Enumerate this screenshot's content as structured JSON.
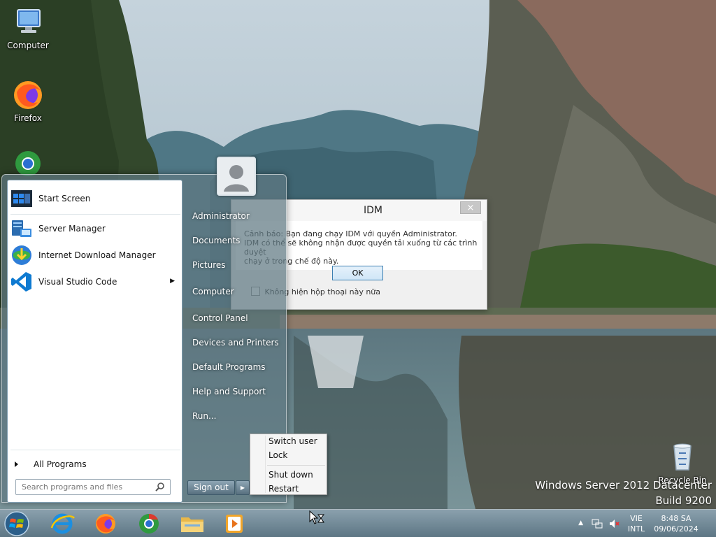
{
  "desktop": {
    "icons": [
      {
        "label": "Computer"
      },
      {
        "label": "Firefox"
      },
      {
        "label": "Recycle Bin"
      }
    ],
    "watermark": {
      "line1": "Windows Server 2012 Datacenter",
      "line2": "Build 9200"
    }
  },
  "idm_dialog": {
    "title": "IDM",
    "close_label": "×",
    "message_line1": "Cảnh báo: Bạn đang chạy IDM với quyền Administrator.",
    "message_line2": "IDM có thể sẽ không nhận được quyền tải xuống từ các trình duyệt",
    "message_line3": "chạy ở trong chế độ này.",
    "ok_label": "OK",
    "checkbox_label": "Không hiện hộp thoại này nữa",
    "checkbox_checked": false
  },
  "start_menu": {
    "programs": [
      {
        "label": "Start Screen",
        "icon": "start-screen-icon"
      },
      {
        "label": "Server Manager",
        "icon": "server-manager-icon"
      },
      {
        "label": "Internet Download Manager",
        "icon": "idm-icon"
      },
      {
        "label": "Visual Studio Code",
        "icon": "vscode-icon",
        "submenu_arrow": "▶"
      }
    ],
    "all_programs": "All Programs",
    "search_placeholder": "Search programs and files",
    "places": [
      "Administrator",
      "Documents",
      "Pictures",
      "Computer",
      "Control Panel",
      "Devices and Printers",
      "Default Programs",
      "Help and Support",
      "Run..."
    ],
    "sign_out": "Sign out",
    "power_arrow": "▶"
  },
  "power_menu": {
    "items": [
      "Switch user",
      "Lock",
      "Shut down",
      "Restart"
    ]
  },
  "taskbar": {
    "pinned": [
      "internet-explorer-icon",
      "firefox-icon",
      "chrome-icon",
      "file-explorer-icon",
      "media-player-icon"
    ],
    "tray": {
      "language_top": "VIE",
      "language_bottom": "INTL",
      "time": "8:48 SA",
      "date": "09/06/2024"
    }
  },
  "colors": {
    "accent": "#3c7fb1",
    "taskbar_top": "#8aa0ad",
    "taskbar_bottom": "#5d7684"
  }
}
